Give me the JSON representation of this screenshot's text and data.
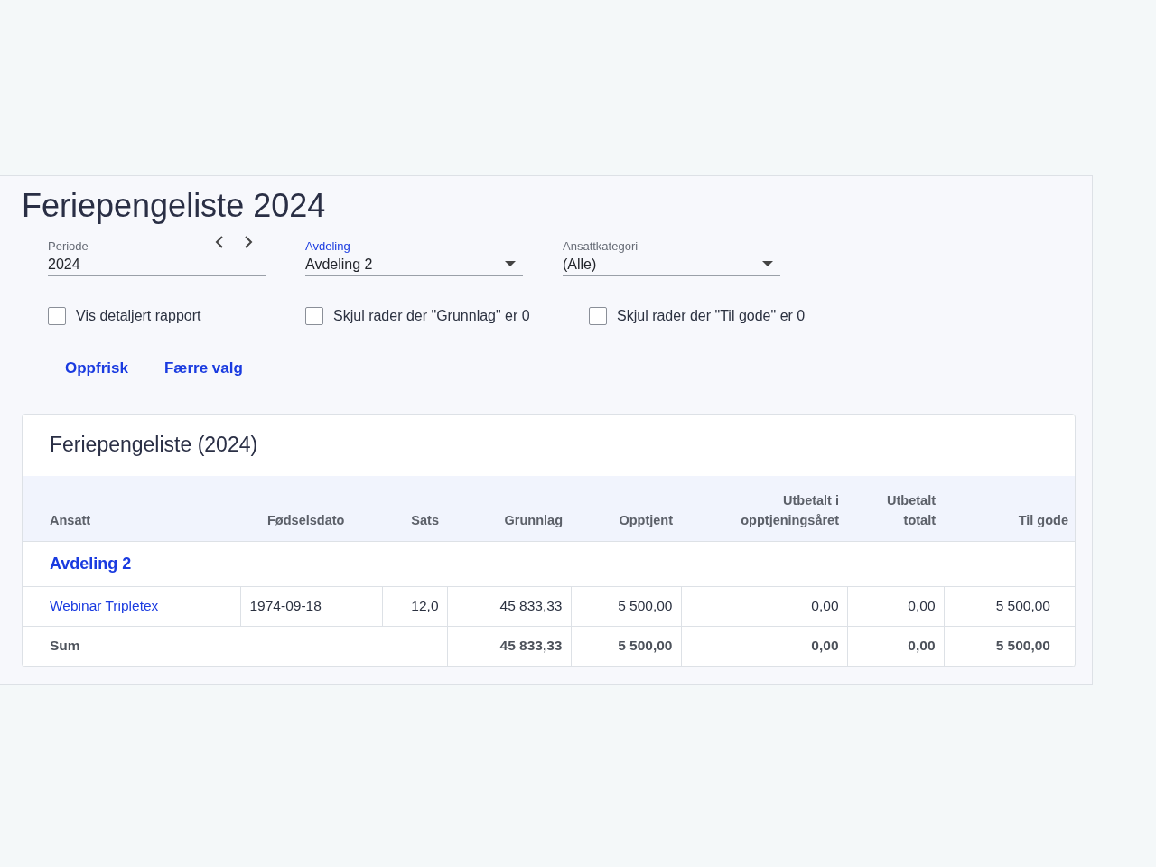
{
  "title": "Feriepengeliste 2024",
  "filters": [
    {
      "kind": "period",
      "label": "Periode",
      "value": "2024",
      "focused": false
    },
    {
      "kind": "select",
      "label": "Avdeling",
      "value": "Avdeling 2",
      "focused": true
    },
    {
      "kind": "select",
      "label": "Ansattkategori",
      "value": "(Alle)",
      "focused": false
    }
  ],
  "checkboxes": [
    {
      "label": "Vis detaljert rapport",
      "checked": false
    },
    {
      "label": "Skjul rader der \"Grunnlag\" er 0",
      "checked": false
    },
    {
      "label": "Skjul rader der \"Til gode\" er 0",
      "checked": false
    }
  ],
  "actions": [
    "Oppfrisk",
    "Færre valg"
  ],
  "report": {
    "title": "Feriepengeliste (2024)",
    "columns": [
      {
        "label": "Ansatt"
      },
      {
        "label": "Fødselsdato"
      },
      {
        "label": "Sats"
      },
      {
        "label": "Grunnlag"
      },
      {
        "label": "Opptjent"
      },
      {
        "label": "Utbetalt i opptjeningsåret"
      },
      {
        "label": "Utbetalt totalt"
      },
      {
        "label": "Til gode"
      }
    ],
    "group": "Avdeling 2",
    "rows": [
      {
        "cells": [
          "Webinar Tripletex",
          "1974-09-18",
          "12,0",
          "45 833,33",
          "5 500,00",
          "0,00",
          "0,00",
          "5 500,00"
        ]
      }
    ],
    "sum": {
      "label": "Sum",
      "values": [
        "45 833,33",
        "5 500,00",
        "0,00",
        "0,00",
        "5 500,00"
      ]
    }
  }
}
